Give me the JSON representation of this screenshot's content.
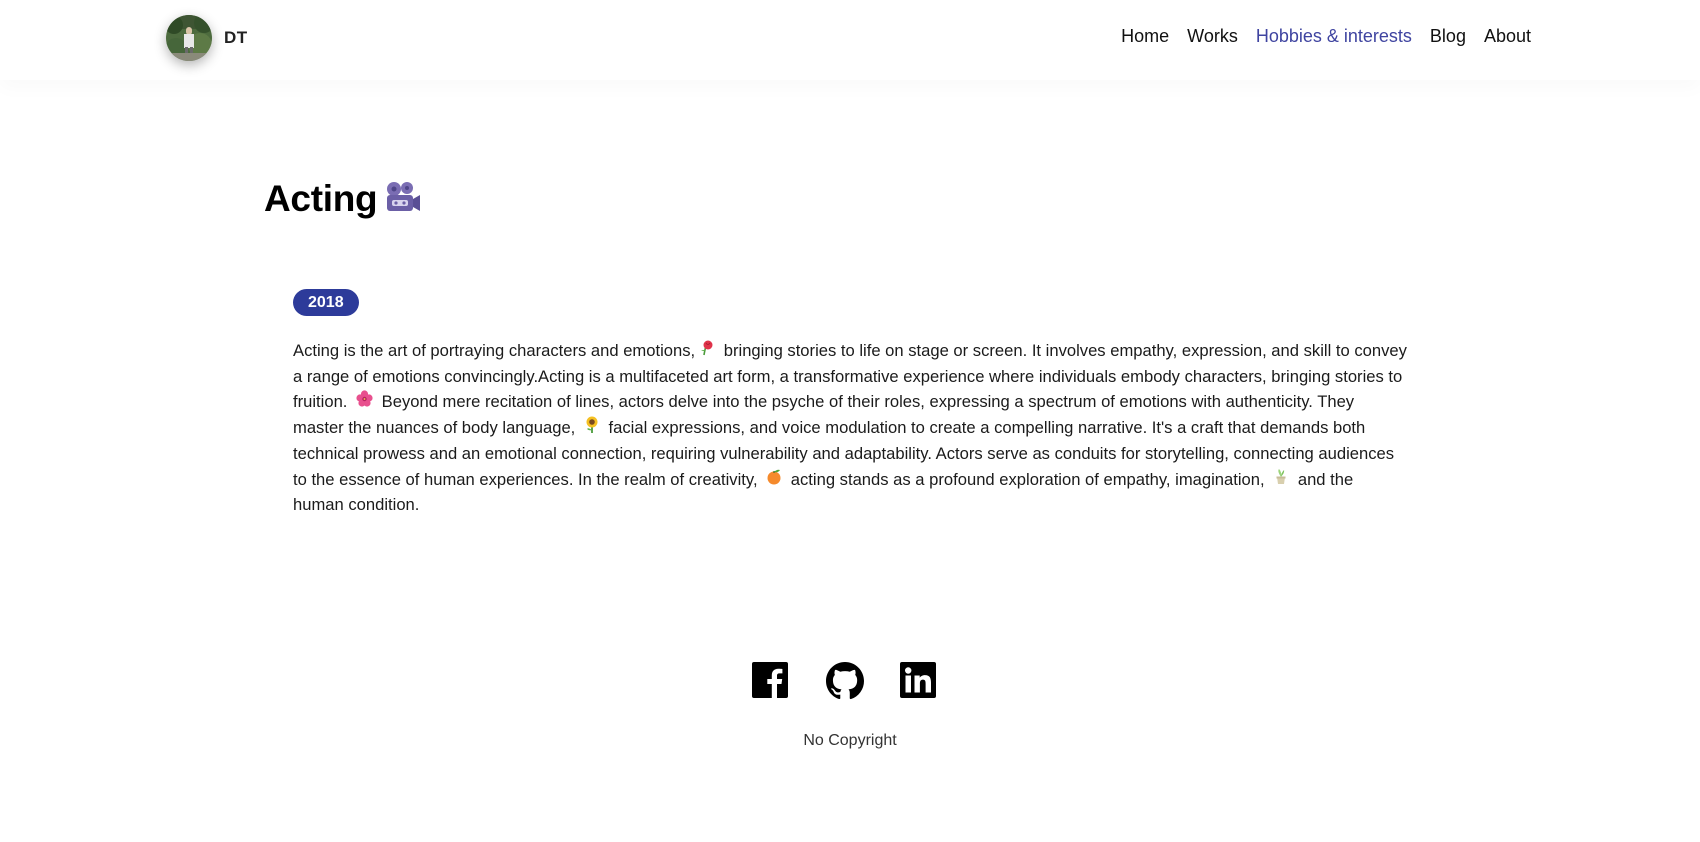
{
  "header": {
    "brand": {
      "name": "DT",
      "avatar_alt": "profile photo"
    },
    "nav": [
      {
        "label": "Home",
        "active": false
      },
      {
        "label": "Works",
        "active": false
      },
      {
        "label": "Hobbies & interests",
        "active": true
      },
      {
        "label": "Blog",
        "active": false
      },
      {
        "label": "About",
        "active": false
      }
    ]
  },
  "main": {
    "title": "Acting",
    "title_icon": "movie-camera-icon",
    "year": "2018",
    "description": {
      "segments": [
        "Acting is the art of portraying characters and emotions,",
        " bringing stories to life on stage or screen. It involves empathy, expression, and skill to convey a range of emotions convincingly.Acting is a multifaceted art form, a transformative experience where individuals embody characters, bringing stories to fruition. ",
        " Beyond mere recitation of lines, actors delve into the psyche of their roles, expressing a spectrum of emotions with authenticity. They master the nuances of body language, ",
        " facial expressions, and voice modulation to create a compelling narrative. It's a craft that demands both technical prowess and an emotional connection, requiring vulnerability and adaptability. Actors serve as conduits for storytelling, connecting audiences to the essence of human experiences. In the realm of creativity, ",
        " acting stands as a profound exploration of empathy, imagination, ",
        " and the human condition."
      ],
      "emojis": [
        "rose-icon",
        "hibiscus-icon",
        "sunflower-icon",
        "tangerine-icon",
        "potted-plant-icon"
      ]
    }
  },
  "footer": {
    "socials": [
      "facebook-icon",
      "github-icon",
      "linkedin-icon"
    ],
    "copyright": "No Copyright"
  },
  "colors": {
    "accent": "#3f44a0",
    "badge": "#2d3b9a"
  }
}
